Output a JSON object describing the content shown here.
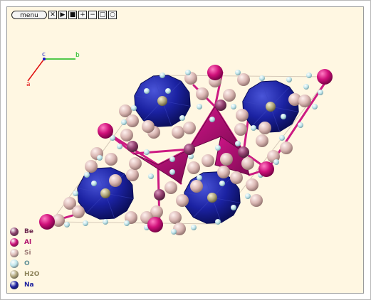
{
  "toolbar": {
    "menu_label": "menu",
    "buttons": [
      {
        "name": "close-button",
        "glyph": "✕"
      },
      {
        "name": "play-button",
        "glyph": "▶"
      },
      {
        "name": "stop-button",
        "glyph": "■"
      },
      {
        "name": "zoom-in-button",
        "glyph": "+"
      },
      {
        "name": "zoom-out-button",
        "glyph": "−"
      },
      {
        "name": "restore-button",
        "glyph": "▢"
      },
      {
        "name": "record-button",
        "glyph": "○"
      }
    ]
  },
  "axes": {
    "a_label": "a",
    "b_label": "b",
    "c_label": "c",
    "a_color": "#e01010",
    "b_color": "#18b818",
    "c_color": "#1818c8"
  },
  "legend": [
    {
      "label": "Be",
      "color": "#8a3f6a",
      "text_color": "#6e2a50"
    },
    {
      "label": "Al",
      "color": "#cc0f78",
      "text_color": "#b0106c"
    },
    {
      "label": "Si",
      "color": "#dbb8b4",
      "text_color": "#9d7a76"
    },
    {
      "label": "O",
      "color": "#bfe4ea",
      "text_color": "#5f8f96"
    },
    {
      "label": "H2O",
      "color": "#b1a77c",
      "text_color": "#8c8258"
    },
    {
      "label": "Na",
      "color": "#1b1f9e",
      "text_color": "#1b1f9e"
    }
  ],
  "colors": {
    "background": "#fff7e2",
    "na_polyhedron": "#141a8a",
    "al_polyhedron": "#b5127a",
    "be_polyhedron": "#8a3f6a"
  }
}
